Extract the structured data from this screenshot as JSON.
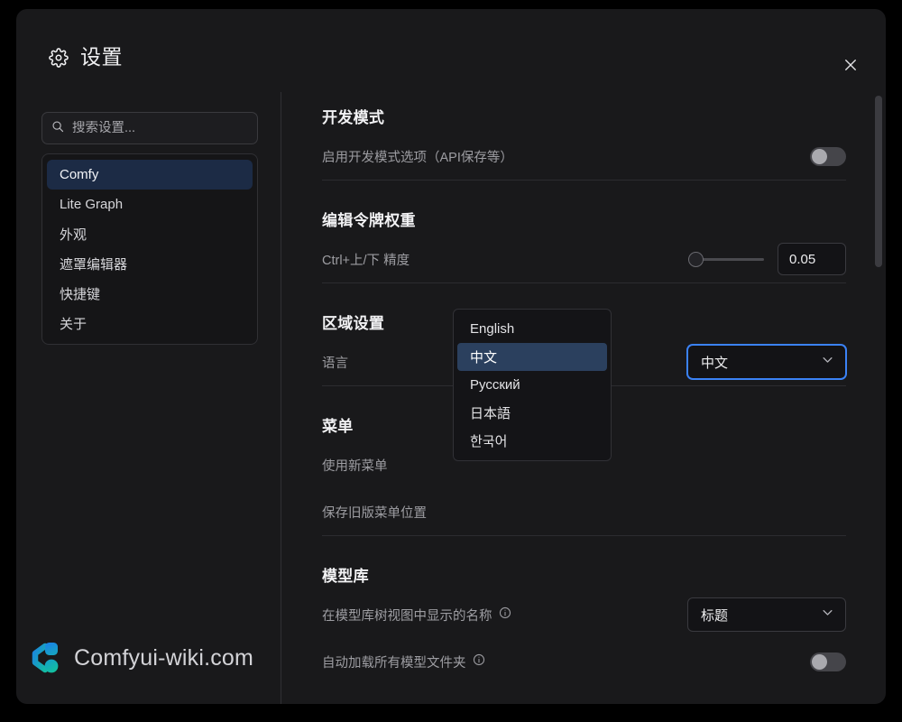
{
  "dialog": {
    "title": "设置",
    "gear_icon": "gear-icon",
    "close_icon": "close-icon"
  },
  "sidebar": {
    "search": {
      "placeholder": "搜索设置...",
      "value": "",
      "icon": "search-icon"
    },
    "items": [
      {
        "label": "Comfy",
        "selected": true
      },
      {
        "label": "Lite Graph",
        "selected": false
      },
      {
        "label": "外观",
        "selected": false
      },
      {
        "label": "遮罩编辑器",
        "selected": false
      },
      {
        "label": "快捷键",
        "selected": false
      },
      {
        "label": "关于",
        "selected": false
      }
    ],
    "watermark": {
      "text": "Comfyui-wiki.com",
      "logo_icon": "comfyui-wiki-logo-icon",
      "color_blue": "#1a7fea",
      "color_teal": "#14b8a6"
    }
  },
  "content": {
    "sections": [
      {
        "title": "开发模式",
        "rows": [
          {
            "label": "启用开发模式选项（API保存等）",
            "control": "toggle",
            "value": "off"
          }
        ]
      },
      {
        "title": "编辑令牌权重",
        "rows": [
          {
            "label": "Ctrl+上/下 精度",
            "control": "slider",
            "value": "0.05"
          }
        ]
      },
      {
        "title": "区域设置",
        "rows": [
          {
            "label": "语言",
            "control": "select",
            "value": "中文"
          }
        ]
      },
      {
        "title": "菜单",
        "rows": [
          {
            "label": "使用新菜单",
            "control": "hidden",
            "value": ""
          },
          {
            "label": "保存旧版菜单位置",
            "control": "hidden",
            "value": ""
          }
        ]
      },
      {
        "title": "模型库",
        "rows": [
          {
            "label": "在模型库树视图中显示的名称",
            "info": "info-icon",
            "control": "select",
            "value": "标题"
          },
          {
            "label": "自动加载所有模型文件夹",
            "info": "info-icon",
            "control": "toggle",
            "value": "off"
          }
        ]
      }
    ],
    "language_dropdown": {
      "open": true,
      "options": [
        {
          "label": "English",
          "selected": false
        },
        {
          "label": "中文",
          "selected": true
        },
        {
          "label": "Русский",
          "selected": false
        },
        {
          "label": "日本語",
          "selected": false
        },
        {
          "label": "한국어",
          "selected": false
        }
      ]
    }
  },
  "colors": {
    "accent_blue": "#3b82f6",
    "selection_bg": "#2b405e",
    "dialog_bg": "#19191b"
  }
}
